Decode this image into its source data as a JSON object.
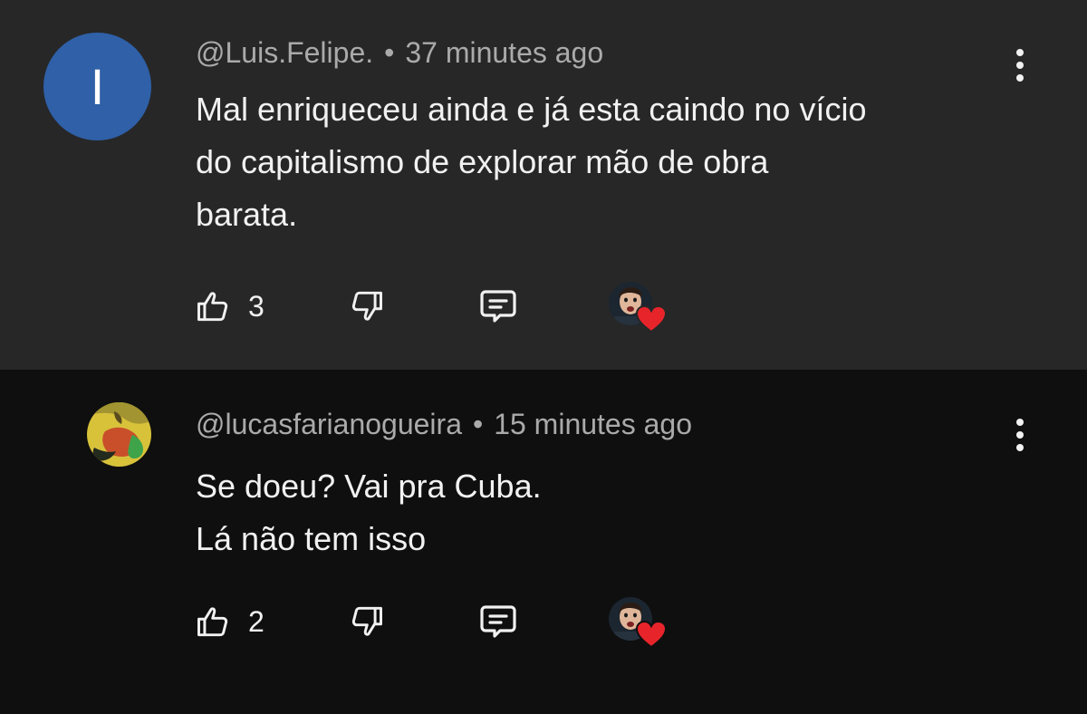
{
  "comments": [
    {
      "avatar_letter": "I",
      "author": "@Luis.Felipe.",
      "separator": "•",
      "time": "37 minutes ago",
      "text_lines": [
        "Mal enriqueceu ainda e já esta caindo no vício",
        "do capitalismo de explorar mão de obra",
        "barata."
      ],
      "likes": "3",
      "icons": {
        "like": "thumbs-up-icon",
        "dislike": "thumbs-down-icon",
        "reply": "reply-comment-icon",
        "more": "more-vertical-icon",
        "heart": "creator-heart-icon"
      }
    },
    {
      "author": "@lucasfarianogueira",
      "separator": "•",
      "time": "15 minutes ago",
      "text_lines": [
        "Se doeu? Vai pra Cuba.",
        "Lá não tem isso"
      ],
      "likes": "2",
      "icons": {
        "like": "thumbs-up-icon",
        "dislike": "thumbs-down-icon",
        "reply": "reply-comment-icon",
        "more": "more-vertical-icon",
        "heart": "creator-heart-icon"
      }
    }
  ],
  "colors": {
    "background_top": "#272727",
    "background_bottom": "#0f0f0f",
    "text": "#f1f1f1",
    "meta_text": "#aaaaaa",
    "avatar_blue": "#2f60a8",
    "heart_red": "#e8242b"
  }
}
